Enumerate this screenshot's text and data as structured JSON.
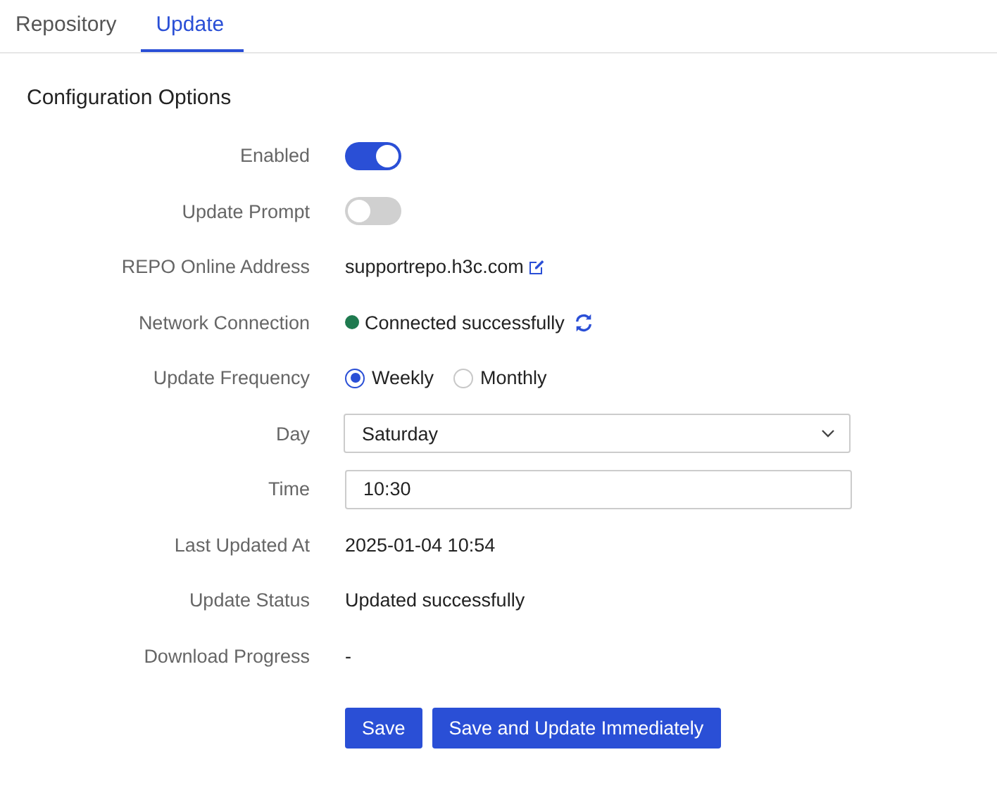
{
  "tabs": [
    {
      "label": "Repository",
      "selected": false
    },
    {
      "label": "Update",
      "selected": true
    }
  ],
  "section_title": "Configuration Options",
  "fields": [
    {
      "kind": "toggle",
      "label": "Enabled",
      "on": true
    },
    {
      "kind": "toggle",
      "label": "Update Prompt",
      "on": false
    },
    {
      "kind": "editable",
      "label": "REPO Online Address",
      "value": "supportrepo.h3c.com"
    },
    {
      "kind": "status",
      "label": "Network Connection",
      "value": "Connected successfully",
      "color": "#1f7a4f"
    },
    {
      "kind": "radio",
      "label": "Update Frequency",
      "options": [
        {
          "label": "Weekly",
          "selected": true
        },
        {
          "label": "Monthly",
          "selected": false
        }
      ]
    },
    {
      "kind": "select",
      "label": "Day",
      "value": "Saturday"
    },
    {
      "kind": "input",
      "label": "Time",
      "value": "10:30"
    },
    {
      "kind": "text",
      "label": "Last Updated At",
      "value": "2025-01-04 10:54"
    },
    {
      "kind": "text",
      "label": "Update Status",
      "value": "Updated successfully"
    },
    {
      "kind": "text",
      "label": "Download Progress",
      "value": "-"
    }
  ],
  "buttons": [
    "Save",
    "Save and Update Immediately"
  ]
}
